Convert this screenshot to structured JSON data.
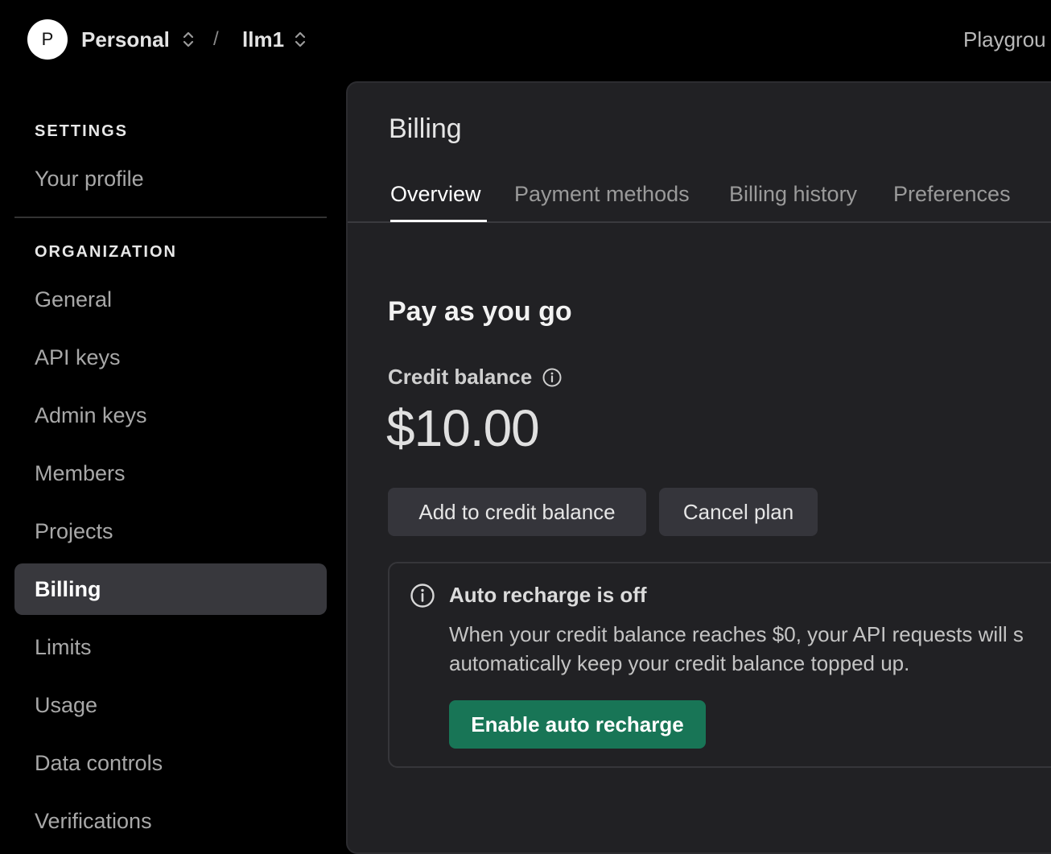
{
  "header": {
    "avatar_letter": "P",
    "org_name": "Personal",
    "separator": "/",
    "project_name": "llm1",
    "right_link": "Playgrou"
  },
  "sidebar": {
    "settings_label": "SETTINGS",
    "settings_items": [
      {
        "label": "Your profile"
      }
    ],
    "organization_label": "ORGANIZATION",
    "org_items": [
      {
        "label": "General"
      },
      {
        "label": "API keys"
      },
      {
        "label": "Admin keys"
      },
      {
        "label": "Members"
      },
      {
        "label": "Projects"
      },
      {
        "label": "Billing",
        "active": true
      },
      {
        "label": "Limits"
      },
      {
        "label": "Usage"
      },
      {
        "label": "Data controls"
      },
      {
        "label": "Verifications"
      }
    ]
  },
  "main": {
    "title": "Billing",
    "tabs": [
      {
        "label": "Overview",
        "active": true
      },
      {
        "label": "Payment methods"
      },
      {
        "label": "Billing history"
      },
      {
        "label": "Preferences"
      }
    ],
    "plan_title": "Pay as you go",
    "credit_label": "Credit balance",
    "credit_amount": "$10.00",
    "add_button": "Add to credit balance",
    "cancel_button": "Cancel plan",
    "notice": {
      "title": "Auto recharge is off",
      "line1": "When your credit balance reaches $0, your API requests will s",
      "line2": "automatically keep your credit balance topped up.",
      "button": "Enable auto recharge"
    }
  },
  "colors": {
    "background": "#000000",
    "panel": "#212124",
    "active_nav": "#38383d",
    "recharge_button": "#187556"
  },
  "icons": {
    "org_switcher": "chevron-up-down-icon",
    "project_switcher": "chevron-up-down-icon",
    "credit_info": "info-icon",
    "notice_info": "info-icon"
  }
}
